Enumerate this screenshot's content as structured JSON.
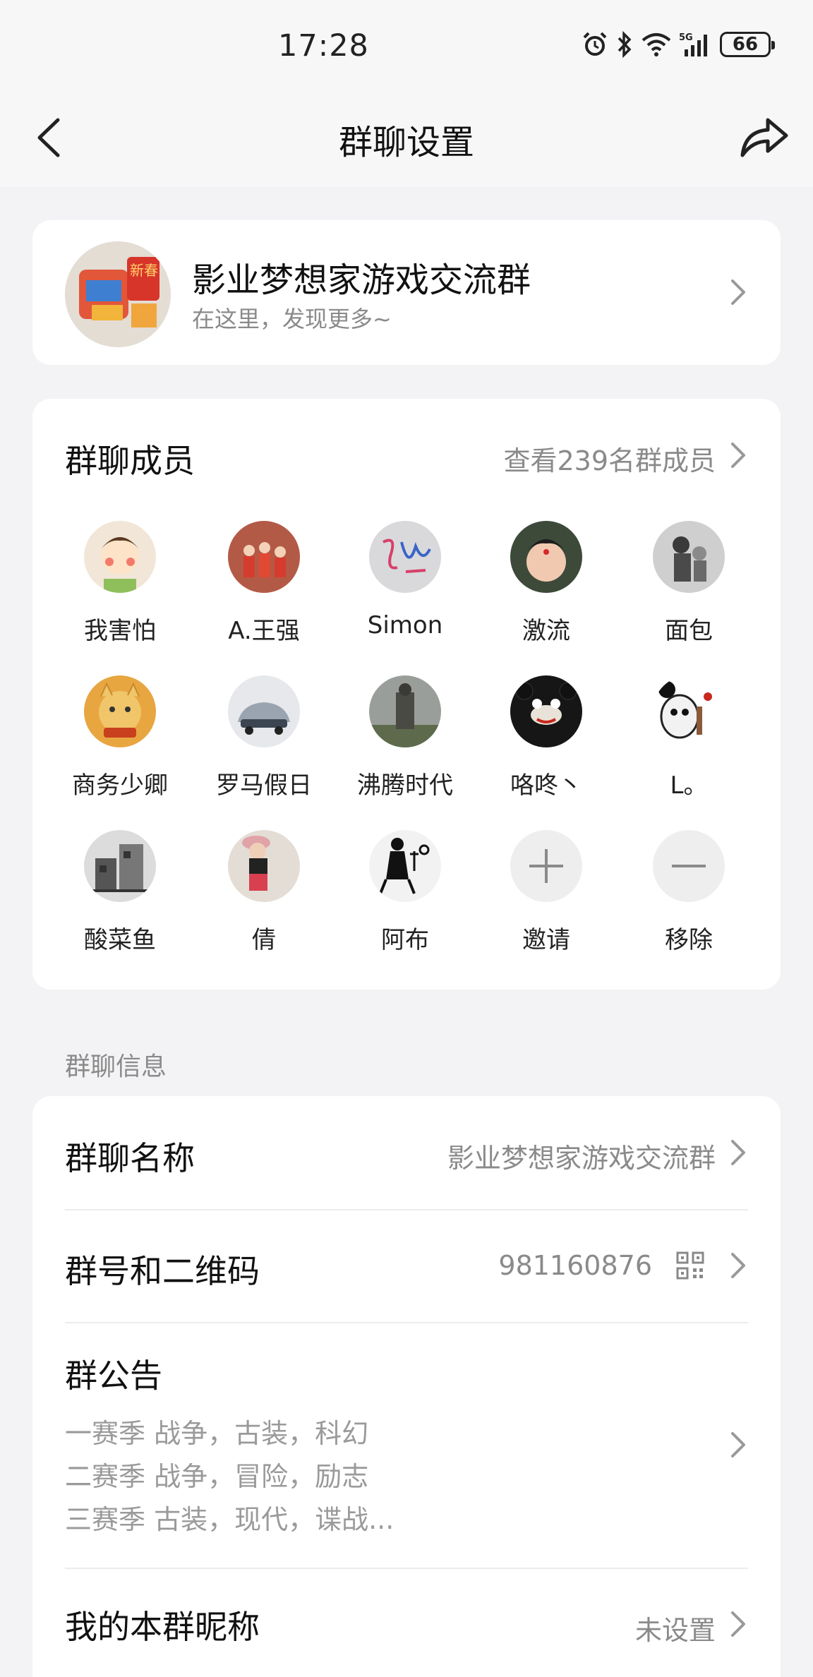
{
  "status_bar": {
    "time": "17:28",
    "icons": [
      "alarm-icon",
      "bluetooth-icon",
      "wifi-icon",
      "signal-5g-icon"
    ],
    "network_label": "5G",
    "battery": "66"
  },
  "nav": {
    "title": "群聊设置",
    "back_icon": "chevron-left-icon",
    "share_icon": "share-icon"
  },
  "group": {
    "name": "影业梦想家游戏交流群",
    "subtitle": "在这里，发现更多~",
    "avatar_badge": "新春"
  },
  "members": {
    "title": "群聊成员",
    "more": "查看239名群成员",
    "list": [
      {
        "name": "我害怕"
      },
      {
        "name": "A.王强"
      },
      {
        "name": "Simon"
      },
      {
        "name": "激流"
      },
      {
        "name": "面包"
      },
      {
        "name": "商务少卿"
      },
      {
        "name": "罗马假日"
      },
      {
        "name": "沸腾时代"
      },
      {
        "name": "咯咚丶"
      },
      {
        "name": "L。"
      },
      {
        "name": "酸菜鱼"
      },
      {
        "name": "倩"
      },
      {
        "name": "阿布"
      }
    ],
    "invite": "邀请",
    "remove": "移除"
  },
  "info": {
    "section_label": "群聊信息",
    "name_title": "群聊名称",
    "name_value": "影业梦想家游戏交流群",
    "id_title": "群号和二维码",
    "id_value": "981160876",
    "notice_title": "群公告",
    "notice_lines": [
      "一赛季 战争，古装，科幻",
      "二赛季 战争，冒险，励志",
      "三赛季 古装，现代，谍战..."
    ],
    "nickname_title": "我的本群昵称",
    "nickname_value": "未设置"
  },
  "colors": {
    "background": "#f3f3f5",
    "card": "#ffffff",
    "primary_text": "#111111",
    "secondary_text": "#8a8a8a"
  }
}
